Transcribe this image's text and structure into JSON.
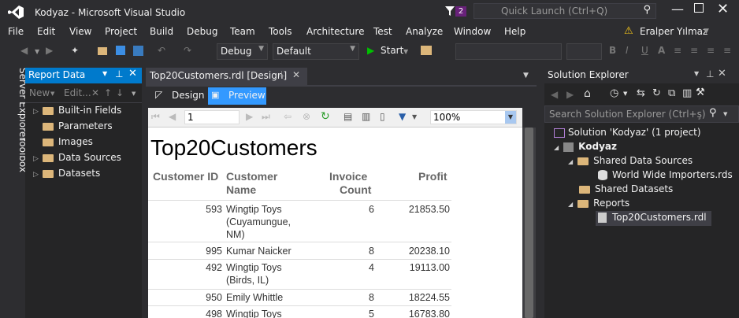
{
  "window": {
    "title": "Kodyaz - Microsoft Visual Studio",
    "notification_count": "2",
    "quick_launch_placeholder": "Quick Launch (Ctrl+Q)",
    "user": "Eralper Yılmaz"
  },
  "menu": [
    "File",
    "Edit",
    "View",
    "Project",
    "Build",
    "Debug",
    "Team",
    "Tools",
    "Architecture",
    "Test",
    "Analyze",
    "Window",
    "Help"
  ],
  "toolbar": {
    "config": "Debug",
    "platform": "Default",
    "start_label": "Start"
  },
  "side_tabs": [
    "Server Explorer",
    "Toolbox"
  ],
  "report_data": {
    "title": "Report Data",
    "new_label": "New",
    "edit_label": "Edit...",
    "items": [
      "Built-in Fields",
      "Parameters",
      "Images",
      "Data Sources",
      "Datasets"
    ]
  },
  "document": {
    "tab_label": "Top20Customers.rdl [Design]",
    "design_tab": "Design",
    "preview_tab": "Preview",
    "page_number": "1",
    "zoom": "100%"
  },
  "report": {
    "title": "Top20Customers",
    "headers": {
      "customer_id": "Customer ID",
      "customer_name_line1": "Customer",
      "customer_name_line2": "Name",
      "invoice_line1": "Invoice",
      "invoice_line2": "Count",
      "profit": "Profit"
    },
    "rows": [
      {
        "id": "593",
        "name1": "Wingtip Toys",
        "name2": "(Cuyamungue,",
        "name3": "NM)",
        "count": "6",
        "profit": "21853.50"
      },
      {
        "id": "995",
        "name1": "Kumar Naicker",
        "name2": "",
        "name3": "",
        "count": "8",
        "profit": "20238.10"
      },
      {
        "id": "492",
        "name1": "Wingtip Toys",
        "name2": "(Birds, IL)",
        "name3": "",
        "count": "4",
        "profit": "19113.00"
      },
      {
        "id": "950",
        "name1": "Emily Whittle",
        "name2": "",
        "name3": "",
        "count": "8",
        "profit": "18224.55"
      },
      {
        "id": "498",
        "name1": "Wingtip Toys",
        "name2": "",
        "name3": "",
        "count": "5",
        "profit": "16783.80"
      }
    ]
  },
  "solution_explorer": {
    "title": "Solution Explorer",
    "search_placeholder": "Search Solution Explorer (Ctrl+ş)",
    "solution": "Solution 'Kodyaz' (1 project)",
    "project": "Kodyaz",
    "shared_data_sources": "Shared Data Sources",
    "data_source_file": "World Wide Importers.rds",
    "shared_datasets": "Shared Datasets",
    "reports": "Reports",
    "report_file": "Top20Customers.rdl"
  },
  "colors": {
    "accent": "#007acc",
    "background": "#2d2d30",
    "panel": "#252526",
    "folder": "#dcb67a"
  }
}
